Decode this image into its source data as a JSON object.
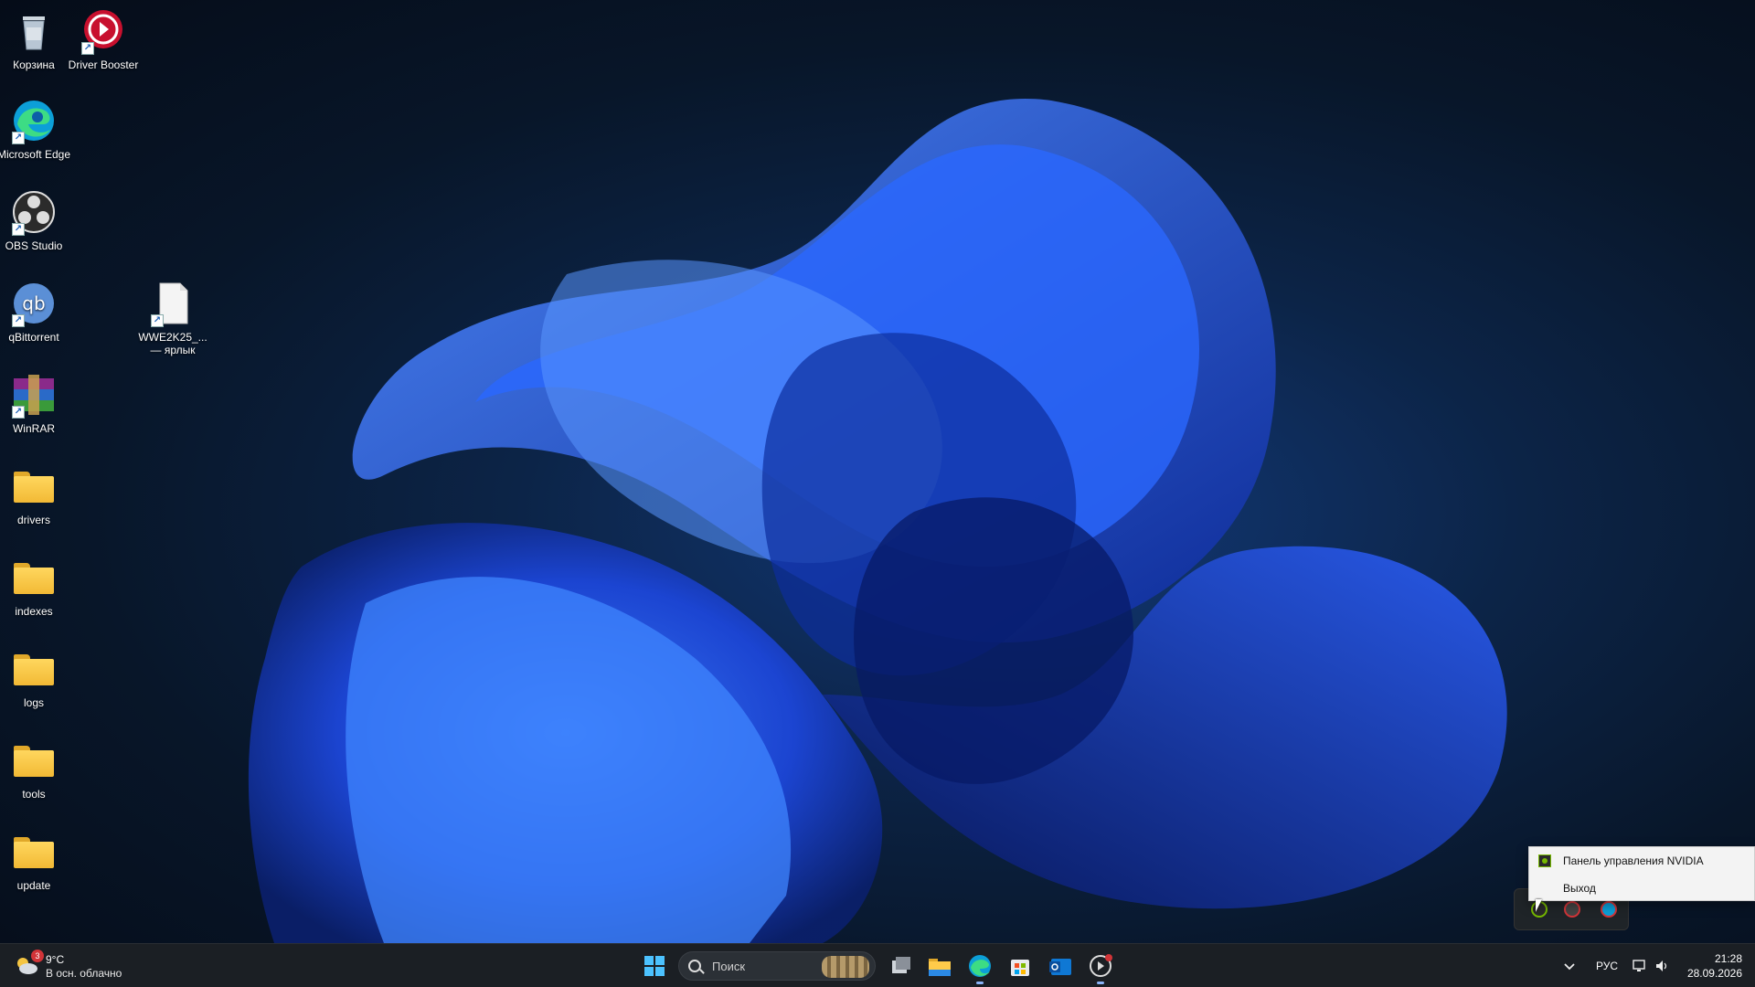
{
  "desktop": {
    "icons": [
      {
        "label": "Корзина",
        "icon": "recycle-bin-icon"
      },
      {
        "label": "Driver Booster",
        "icon": "driver-booster-icon",
        "shortcut": true
      },
      {
        "label": "Microsoft Edge",
        "icon": "edge-icon",
        "shortcut": true
      },
      {
        "label": "OBS Studio",
        "icon": "obs-icon",
        "shortcut": true
      },
      {
        "label": "qBittorrent",
        "icon": "qbittorrent-icon",
        "shortcut": true
      },
      {
        "label": "WWE2K25_... — ярлык",
        "icon": "file-shortcut-icon",
        "shortcut": true
      },
      {
        "label": "WinRAR",
        "icon": "winrar-icon",
        "shortcut": true
      },
      {
        "label": "drivers",
        "icon": "folder-icon"
      },
      {
        "label": "indexes",
        "icon": "folder-icon"
      },
      {
        "label": "logs",
        "icon": "folder-icon"
      },
      {
        "label": "tools",
        "icon": "folder-icon"
      },
      {
        "label": "update",
        "icon": "folder-icon"
      }
    ],
    "shortcut_arrow": "↗"
  },
  "context_menu": {
    "items": [
      {
        "label": "Панель управления NVIDIA",
        "icon": "nvidia-icon"
      },
      {
        "label": "Выход"
      }
    ]
  },
  "taskbar": {
    "weather": {
      "temp": "9°C",
      "desc": "В осн. облачно",
      "badge": "3"
    },
    "search": {
      "placeholder": "Поиск"
    },
    "apps": [
      "start-icon",
      "task-view-icon",
      "file-explorer-icon",
      "edge-icon",
      "store-icon",
      "outlook-icon",
      "driver-booster-icon"
    ],
    "tray": {
      "language": "РУС",
      "time": "21:28",
      "date": "28.09.2026"
    }
  },
  "colors": {
    "taskbar_bg": "#1b1f24",
    "wallpaper_accent": "#1f4fe0",
    "nvidia_green": "#76b900"
  }
}
